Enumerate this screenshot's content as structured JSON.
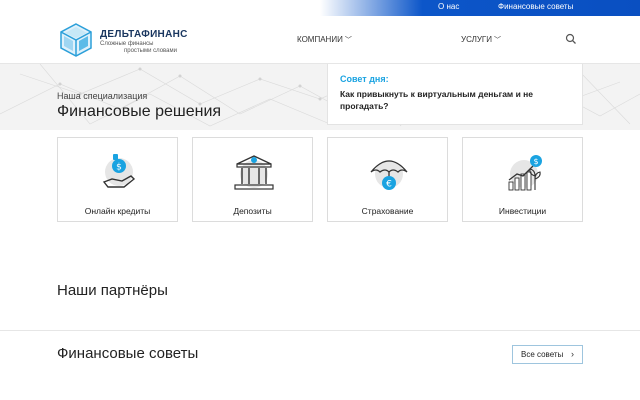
{
  "topbar": {
    "about": "О нас",
    "advice": "Финансовые советы"
  },
  "header": {
    "brand": "ДЕЛЬТАФИНАНС",
    "tagline_line1": "Сложные финансы",
    "tagline_line2": "простыми словами",
    "nav": [
      {
        "label": "КОМПАНИИ"
      },
      {
        "label": "УСЛУГИ"
      }
    ]
  },
  "hero": {
    "subtitle": "Наша специализация",
    "title": "Финансовые решения",
    "tip_label": "Совет дня:",
    "tip_text": "Как привыкнуть к виртуальным деньгам и не прогадать?"
  },
  "cards": [
    {
      "label": "Онлайн кредиты",
      "icon": "money-hand-icon"
    },
    {
      "label": "Депозиты",
      "icon": "bank-icon"
    },
    {
      "label": "Страхование",
      "icon": "umbrella-euro-icon"
    },
    {
      "label": "Инвестиции",
      "icon": "growth-chart-icon"
    }
  ],
  "partners_title": "Наши партнёры",
  "advice_section": {
    "title": "Финансовые советы",
    "button": "Все советы"
  },
  "colors": {
    "accent": "#1aa3e1",
    "brand_blue": "#0c56c9",
    "dark": "#1a3760"
  }
}
